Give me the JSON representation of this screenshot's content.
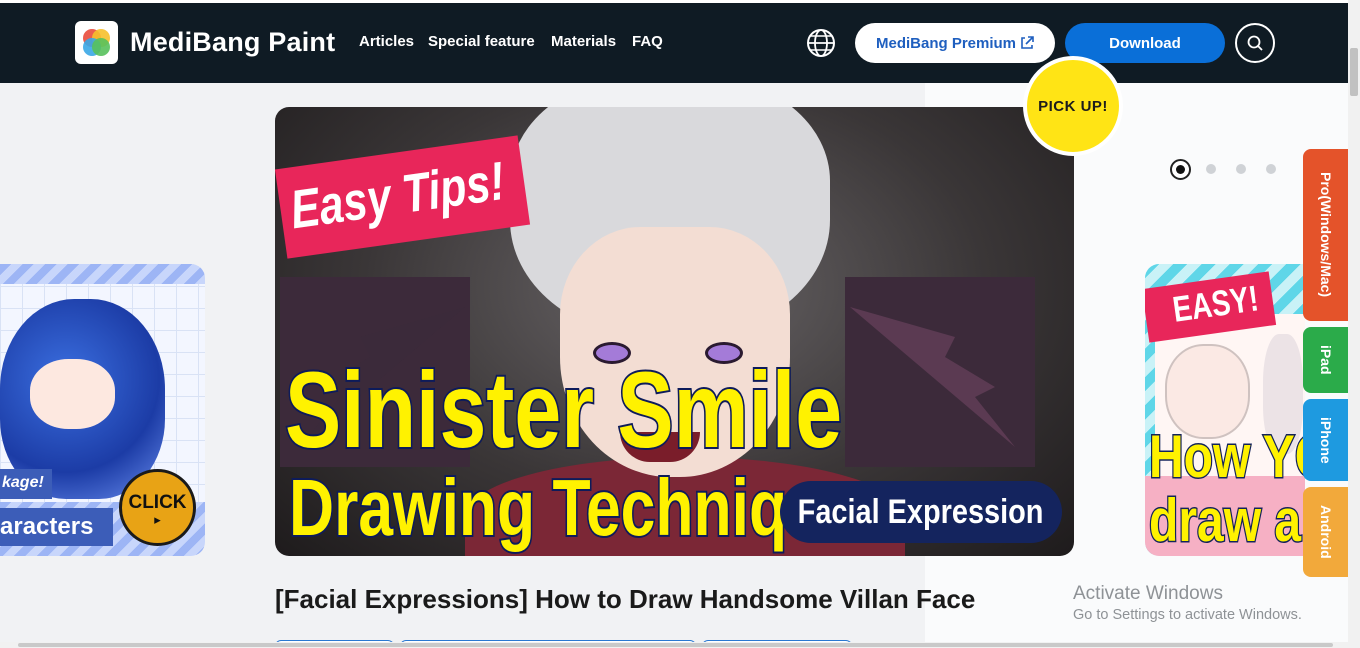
{
  "header": {
    "brand": "MediBang Paint",
    "nav": [
      "Articles",
      "Special feature",
      "Materials",
      "FAQ"
    ],
    "premium_label": "MediBang Premium",
    "download_label": "Download"
  },
  "carousel": {
    "badge": "PICK UP!",
    "main_slide": {
      "ribbon": "Easy Tips!",
      "line1": "Sinister Smile",
      "line2": "Drawing Technique",
      "pill": "Facial Expression"
    },
    "left_slide": {
      "tag_small": "kage!",
      "tag_large": "aracters",
      "click": "CLICK",
      "click_arrow": "▸"
    },
    "right_slide": {
      "ribbon": "EASY!",
      "line1": "How YO",
      "line2": "draw a"
    },
    "dots": {
      "count": 4,
      "active": 1
    }
  },
  "side_tabs": [
    {
      "label": "Pro(Windows/Mac)",
      "color": "#e4532a"
    },
    {
      "label": "iPad",
      "color": "#2bab4a"
    },
    {
      "label": "iPhone",
      "color": "#1e9ae0"
    },
    {
      "label": "Android",
      "color": "#f2a93b"
    }
  ],
  "article": {
    "title": "[Facial Expressions] How to Draw Handsome Villan Face"
  },
  "watermark": {
    "title": "Activate Windows",
    "subtitle": "Go to Settings to activate Windows."
  },
  "colors": {
    "header_bg": "#0f1b24",
    "download_bg": "#0a6fd8",
    "premium_text": "#1f5fbf",
    "pickup_bg": "#ffe415"
  }
}
